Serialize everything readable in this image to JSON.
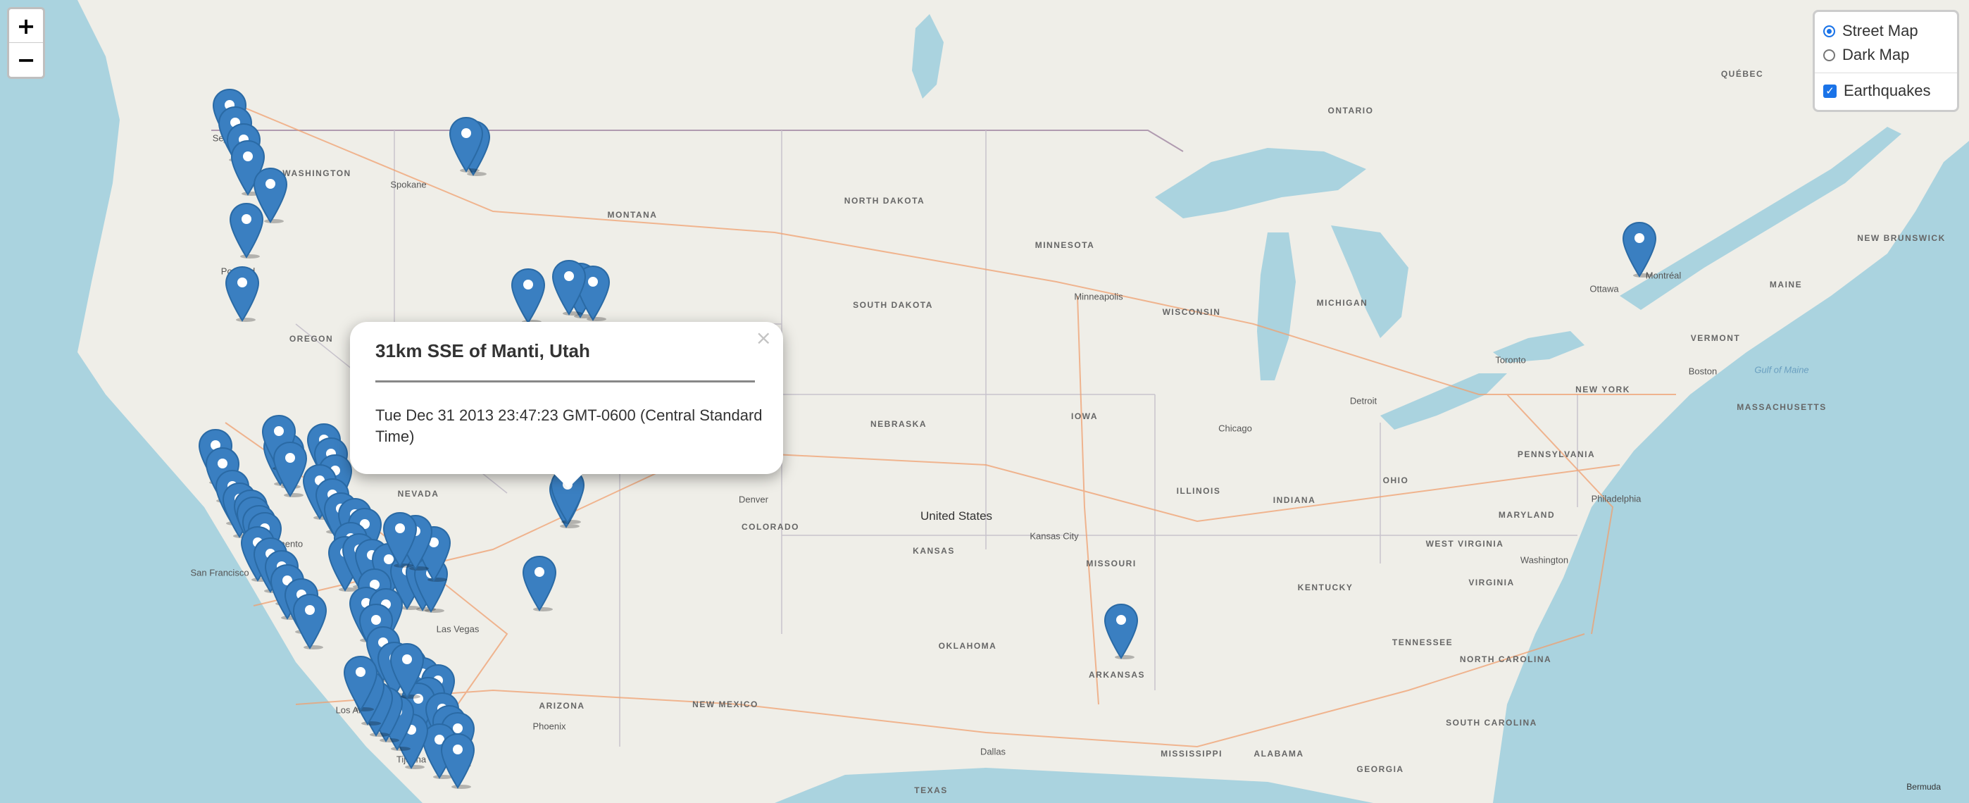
{
  "map": {
    "labels": [
      {
        "text": "WASHINGTON",
        "kind": "state"
      },
      {
        "text": "OREGON",
        "kind": "state"
      },
      {
        "text": "MONTANA",
        "kind": "state"
      },
      {
        "text": "NORTH DAKOTA",
        "kind": "state"
      },
      {
        "text": "SOUTH DAKOTA",
        "kind": "state"
      },
      {
        "text": "MINNESOTA",
        "kind": "state"
      },
      {
        "text": "WISCONSIN",
        "kind": "state"
      },
      {
        "text": "MICHIGAN",
        "kind": "state"
      },
      {
        "text": "NEBRASKA",
        "kind": "state"
      },
      {
        "text": "IOWA",
        "kind": "state"
      },
      {
        "text": "ILLINOIS",
        "kind": "state"
      },
      {
        "text": "INDIANA",
        "kind": "state"
      },
      {
        "text": "OHIO",
        "kind": "state"
      },
      {
        "text": "PENNSYLVANIA",
        "kind": "state"
      },
      {
        "text": "NEW YORK",
        "kind": "state"
      },
      {
        "text": "NEVADA",
        "kind": "state"
      },
      {
        "text": "COLORADO",
        "kind": "state"
      },
      {
        "text": "KANSAS",
        "kind": "state"
      },
      {
        "text": "MISSOURI",
        "kind": "state"
      },
      {
        "text": "KENTUCKY",
        "kind": "state"
      },
      {
        "text": "VIRGINIA",
        "kind": "state"
      },
      {
        "text": "WEST VIRGINIA",
        "kind": "state"
      },
      {
        "text": "MARYLAND",
        "kind": "state"
      },
      {
        "text": "TENNESSEE",
        "kind": "state"
      },
      {
        "text": "OKLAHOMA",
        "kind": "state"
      },
      {
        "text": "ARKANSAS",
        "kind": "state"
      },
      {
        "text": "NEW MEXICO",
        "kind": "state"
      },
      {
        "text": "ARIZONA",
        "kind": "state"
      },
      {
        "text": "TEXAS",
        "kind": "state"
      },
      {
        "text": "MISSISSIPPI",
        "kind": "state"
      },
      {
        "text": "ALABAMA",
        "kind": "state"
      },
      {
        "text": "GEORGIA",
        "kind": "state"
      },
      {
        "text": "SOUTH CAROLINA",
        "kind": "state"
      },
      {
        "text": "NORTH CAROLINA",
        "kind": "state"
      },
      {
        "text": "VERMONT",
        "kind": "state"
      },
      {
        "text": "MAINE",
        "kind": "state"
      },
      {
        "text": "ONTARIO",
        "kind": "state"
      },
      {
        "text": "QUÉBEC",
        "kind": "state"
      },
      {
        "text": "NEW BRUNSWICK",
        "kind": "state"
      },
      {
        "text": "MASSACHUSETTS",
        "kind": "state"
      },
      {
        "text": "United States",
        "kind": "country"
      },
      {
        "text": "Seattle",
        "kind": "city"
      },
      {
        "text": "Portland",
        "kind": "city"
      },
      {
        "text": "Spokane",
        "kind": "city"
      },
      {
        "text": "Sacramento",
        "kind": "city"
      },
      {
        "text": "San Francisco",
        "kind": "city"
      },
      {
        "text": "Las Vegas",
        "kind": "city"
      },
      {
        "text": "Los Angeles",
        "kind": "city"
      },
      {
        "text": "Phoenix",
        "kind": "city"
      },
      {
        "text": "Denver",
        "kind": "city"
      },
      {
        "text": "Chicago",
        "kind": "city"
      },
      {
        "text": "Detroit",
        "kind": "city"
      },
      {
        "text": "Toronto",
        "kind": "city"
      },
      {
        "text": "Montréal",
        "kind": "city"
      },
      {
        "text": "Ottawa",
        "kind": "city"
      },
      {
        "text": "Boston",
        "kind": "city"
      },
      {
        "text": "Philadelphia",
        "kind": "city"
      },
      {
        "text": "Washington",
        "kind": "city"
      },
      {
        "text": "Dallas",
        "kind": "city"
      },
      {
        "text": "Minneapolis",
        "kind": "city"
      },
      {
        "text": "Kansas City",
        "kind": "city"
      },
      {
        "text": "Tijuana",
        "kind": "city"
      },
      {
        "text": "Gulf of Maine",
        "kind": "water"
      }
    ],
    "attribution": "Bermuda"
  },
  "controls": {
    "zoom_in": "+",
    "zoom_out": "−",
    "base_layers": [
      {
        "label": "Street Map",
        "selected": true
      },
      {
        "label": "Dark Map",
        "selected": false
      }
    ],
    "overlays": [
      {
        "label": "Earthquakes",
        "checked": true
      }
    ]
  },
  "popup": {
    "title": "31km SSE of Manti, Utah",
    "time": "Tue Dec 31 2013 23:47:23 GMT-0600 (Central Standard Time)",
    "close": "×"
  },
  "markers": {
    "count": 78,
    "color": "#3a7fc1",
    "icon": "map-marker-icon"
  }
}
